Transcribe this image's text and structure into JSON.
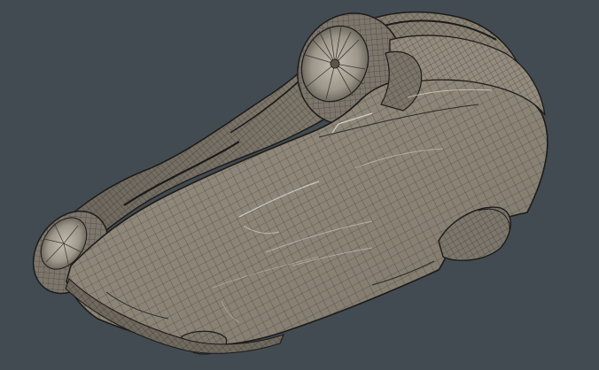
{
  "scene": {
    "subject": "car-underside-wireframe-render",
    "colors": {
      "background": "#434b52",
      "body_fill": "#8a8274",
      "body_fill_light": "#9a9283",
      "body_shadow": "#6f695e",
      "body_dark": "#4e4b45",
      "wire": "#3a3732",
      "wire_light": "#b8b2a6",
      "tire": "#7c766c",
      "tire_dark": "#5a554d",
      "rim": "#a7a196",
      "outline": "#1c1b19",
      "highlight": "#d6d1c6"
    }
  }
}
